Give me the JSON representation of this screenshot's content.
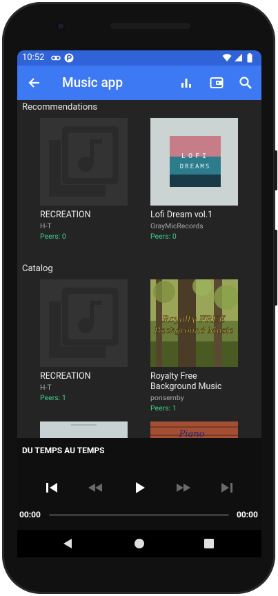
{
  "status": {
    "time": "10:52"
  },
  "appbar": {
    "title": "Music app",
    "icons": [
      "back-arrow-icon",
      "equalizer-icon",
      "wallet-icon",
      "search-icon"
    ]
  },
  "sections": {
    "recommendations": {
      "title": "Recommendations",
      "items": [
        {
          "name": "RECREATION",
          "artist": "H-T",
          "peers": "Peers: 0",
          "art": "placeholder-music-icon"
        },
        {
          "name": "Lofi Dream vol.1",
          "artist": "GrayMicRecords",
          "peers": "Peers: 0",
          "art": "lofi-dreams-cover",
          "art_text_1": "LOFI",
          "art_text_2": "DREAMS"
        }
      ]
    },
    "catalog": {
      "title": "Catalog",
      "items": [
        {
          "name": "RECREATION",
          "artist": "H-T",
          "peers": "Peers: 1",
          "art": "placeholder-music-icon"
        },
        {
          "name": "Royalty Free Background Music",
          "artist": "ponsemby",
          "peers": "Peers: 1",
          "art": "forest-cover",
          "art_text_1": "Royalty FREE",
          "art_text_2": "Background Music"
        },
        {
          "name": "",
          "artist": "",
          "peers": "",
          "art": "light-cover"
        },
        {
          "name": "",
          "artist": "",
          "peers": "",
          "art": "piano-brick-cover",
          "art_text_1": "Piano"
        }
      ]
    }
  },
  "player": {
    "track": "DU TEMPS AU TEMPS",
    "elapsed": "00:00",
    "duration": "00:00",
    "progress": 0,
    "controls": [
      "skip-previous-icon",
      "rewind-icon",
      "play-icon",
      "fast-forward-icon",
      "skip-next-icon"
    ]
  },
  "nav": {
    "icons": [
      "nav-back-icon",
      "nav-home-icon",
      "nav-recents-icon"
    ]
  },
  "colors": {
    "statusbar": "#3063d8",
    "appbar": "#3d79f2",
    "peers": "#3ed08a",
    "background": "#242424",
    "player": "#0f0f0f"
  }
}
